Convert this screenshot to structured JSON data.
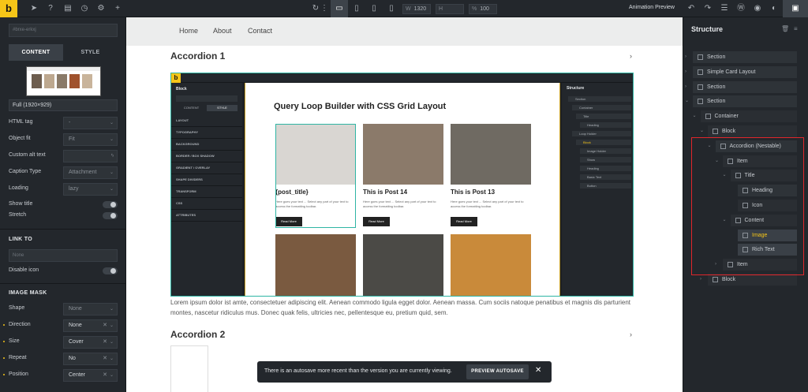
{
  "topbar": {
    "logo": "b",
    "zoom": "100",
    "width_label": "W",
    "width_value": "1320",
    "height_label": "H",
    "percent_label": "%",
    "animation_preview": "Animation Preview"
  },
  "left": {
    "search_placeholder": "#brxe-erkxj",
    "tab_content": "CONTENT",
    "tab_style": "STYLE",
    "size": "Full (1920×929)",
    "rows": [
      {
        "label": "HTML tag",
        "value": "-",
        "has_value": false
      },
      {
        "label": "Object fit",
        "value": "Fit",
        "has_value": false
      },
      {
        "label": "Custom alt text",
        "value": "",
        "has_value": false
      },
      {
        "label": "Caption Type",
        "value": "Attachment",
        "has_value": false
      },
      {
        "label": "Loading",
        "value": "lazy",
        "has_value": false
      }
    ],
    "toggles": [
      {
        "label": "Show title"
      },
      {
        "label": "Stretch"
      }
    ],
    "link_to": "LINK TO",
    "link_value": "None",
    "disable_icon": "Disable icon",
    "image_mask": "IMAGE MASK",
    "mask_rows": [
      {
        "label": "Shape",
        "value": "None",
        "dot": false,
        "has_value": false
      },
      {
        "label": "Direction",
        "value": "None",
        "dot": true,
        "has_value": true
      },
      {
        "label": "Size",
        "value": "Cover",
        "dot": true,
        "has_value": true
      },
      {
        "label": "Repeat",
        "value": "No",
        "dot": true,
        "has_value": true
      },
      {
        "label": "Position",
        "value": "Center",
        "dot": true,
        "has_value": true
      }
    ]
  },
  "canvas": {
    "nav": [
      "Home",
      "About",
      "Contact"
    ],
    "accordion1": "Accordion 1",
    "accordion2": "Accordion 2",
    "query_title": "Query Loop Builder with CSS Grid Layout",
    "cards": [
      {
        "title": "{post_title}",
        "text": "Here goes your text ... Select any part of your text to access the formatting toolbar.",
        "button": "Read More",
        "color": "#d9d6d2"
      },
      {
        "title": "This is Post 14",
        "text": "Here goes your text ... Select any part of your text to access the formatting toolbar.",
        "button": "Read More",
        "color": "#8b7a6a"
      },
      {
        "title": "This is Post 13",
        "text": "Here goes your text ... Select any part of your text to access the formatting toolbar.",
        "button": "Read More",
        "color": "#6f6a62"
      }
    ],
    "row2_colors": [
      "#7a5a40",
      "#4b4a46",
      "#c98a3a"
    ],
    "embed": {
      "panel_title": "Block",
      "tab_content": "CONTENT",
      "tab_style": "STYLE",
      "right_title": "Structure",
      "panel_groups": [
        "LAYOUT",
        "TYPOGRAPHY",
        "BACKGROUND",
        "BORDER / BOX SHADOW",
        "GRADIENT / OVERLAY",
        "SHAPE DIVIDERS",
        "TRANSFORM",
        "CSS",
        "ATTRIBUTES"
      ],
      "tree": [
        "Section",
        "Container",
        "Title",
        "Heading",
        "Loop Holder",
        "Block",
        "Image Holder",
        "Show",
        "Heading",
        "Basic Text",
        "Button"
      ]
    },
    "lorem": "Lorem ipsum dolor ist amte, consectetuer adipiscing elit. Aenean commodo ligula egget dolor. Aenean massa. Cum sociis natoque penatibus et magnis dis parturient montes, nascetur ridiculus mus. Donec quak felis, ultricies nec, pellentesque eu, pretium quid, sem.",
    "toast": {
      "message": "There is an autosave more recent than the version you are currently viewing.",
      "button": "PREVIEW AUTOSAVE"
    }
  },
  "structure": {
    "title": "Structure",
    "items": [
      {
        "label": "Section",
        "indent": 0,
        "chev": "›",
        "style": "normal"
      },
      {
        "label": "Simple Card Layout",
        "indent": 0,
        "chev": "›",
        "style": "normal"
      },
      {
        "label": "Section",
        "indent": 0,
        "chev": "›",
        "style": "normal"
      },
      {
        "label": "Section",
        "indent": 0,
        "chev": "⌄",
        "style": "normal"
      },
      {
        "label": "Container",
        "indent": 1,
        "chev": "⌄",
        "style": "dark"
      },
      {
        "label": "Block",
        "indent": 2,
        "chev": "⌄",
        "style": "dark"
      },
      {
        "label": "Accordion (Nestable)",
        "indent": 3,
        "chev": "⌄",
        "style": "normal"
      },
      {
        "label": "Item",
        "indent": 4,
        "chev": "⌄",
        "style": "dark"
      },
      {
        "label": "Title",
        "indent": 5,
        "chev": "⌄",
        "style": "dark"
      },
      {
        "label": "Heading",
        "indent": 6,
        "chev": "",
        "style": "normal"
      },
      {
        "label": "Icon",
        "indent": 6,
        "chev": "",
        "style": "dark"
      },
      {
        "label": "Content",
        "indent": 5,
        "chev": "⌄",
        "style": "dark"
      },
      {
        "label": "Image",
        "indent": 6,
        "chev": "",
        "style": "light",
        "accent": true
      },
      {
        "label": "Rich Text",
        "indent": 6,
        "chev": "",
        "style": "light"
      },
      {
        "label": "Item",
        "indent": 4,
        "chev": "›",
        "style": "dark"
      },
      {
        "label": "Block",
        "indent": 2,
        "chev": "›",
        "style": "dark"
      }
    ]
  }
}
